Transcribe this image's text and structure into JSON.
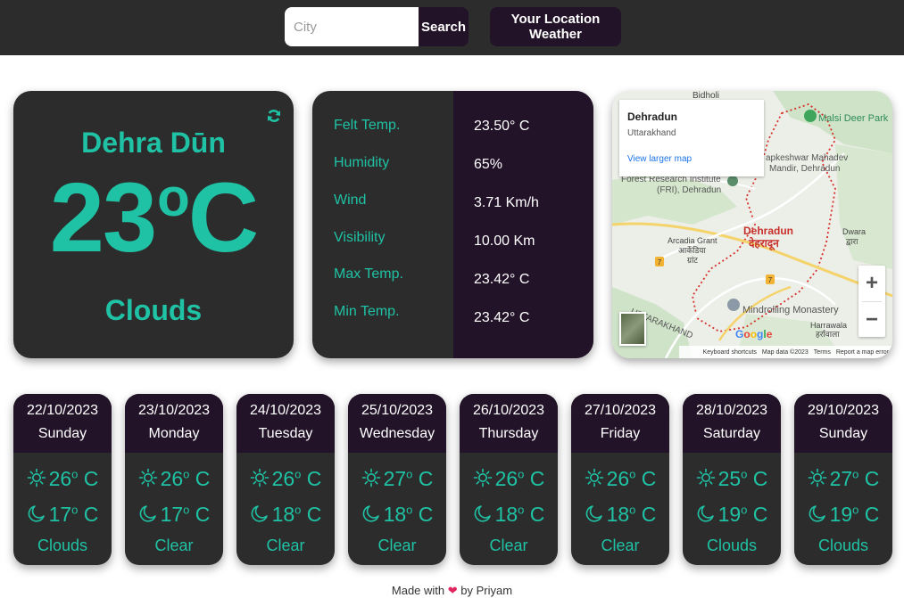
{
  "header": {
    "search_placeholder": "City",
    "search_label": "Search",
    "location_label": "Your Location Weather"
  },
  "current": {
    "city": "Dehra Dūn",
    "temp": "23",
    "unit": "o",
    "unit_letter": "C",
    "condition": "Clouds"
  },
  "details": [
    {
      "label": "Felt Temp.",
      "value": "23.50° C"
    },
    {
      "label": "Humidity",
      "value": "65%"
    },
    {
      "label": "Wind",
      "value": "3.71 Km/h"
    },
    {
      "label": "Visibility",
      "value": "10.00 Km"
    },
    {
      "label": "Max Temp.",
      "value": "23.42° C"
    },
    {
      "label": "Min Temp.",
      "value": "23.42° C"
    }
  ],
  "map": {
    "place_title": "Dehradun",
    "place_sub": "Uttarakhand",
    "view_larger": "View larger map",
    "labels": {
      "bidholi": "Bidholi",
      "malsi": "Malsi Deer Park",
      "tapkeshwar": "apkeshwar Mahadev",
      "tapkeshwar2": "Mandir, Dehradun",
      "fri": "Forest Research Institute",
      "fri2": "(FRI), Dehradun",
      "arcadia": "Arcadia Grant",
      "arcadia_hi": "आर्केडिया",
      "arcadia_hi2": "ग्रांट",
      "dehradun": "Dehradun",
      "dehradun_hi": "देहरादून",
      "dwara": "Dwara",
      "dwara_hi": "द्वारा",
      "mindrolling": "Mindrolling Monastery",
      "harrawala": "Harrawala",
      "harrawala_hi": "हर्रावाला",
      "uttarakhand": "UTTARAKHAND",
      "road7a": "7",
      "road7b": "7"
    },
    "google": "Google",
    "footer": {
      "shortcuts": "Keyboard shortcuts",
      "data": "Map data ©2023",
      "terms": "Terms",
      "report": "Report a map error"
    }
  },
  "forecast": [
    {
      "date": "22/10/2023",
      "day": "Sunday",
      "max": "26",
      "min": "17",
      "cond": "Clouds"
    },
    {
      "date": "23/10/2023",
      "day": "Monday",
      "max": "26",
      "min": "17",
      "cond": "Clear"
    },
    {
      "date": "24/10/2023",
      "day": "Tuesday",
      "max": "26",
      "min": "18",
      "cond": "Clear"
    },
    {
      "date": "25/10/2023",
      "day": "Wednesday",
      "max": "27",
      "min": "18",
      "cond": "Clear"
    },
    {
      "date": "26/10/2023",
      "day": "Thursday",
      "max": "26",
      "min": "18",
      "cond": "Clear"
    },
    {
      "date": "27/10/2023",
      "day": "Friday",
      "max": "26",
      "min": "18",
      "cond": "Clear"
    },
    {
      "date": "28/10/2023",
      "day": "Saturday",
      "max": "25",
      "min": "19",
      "cond": "Clouds"
    },
    {
      "date": "29/10/2023",
      "day": "Sunday",
      "max": "27",
      "min": "19",
      "cond": "Clouds"
    }
  ],
  "temp_unit": {
    "deg": "o",
    "letter": " C"
  },
  "footer": {
    "made_with": "Made with",
    "by": "by Priyam"
  },
  "colors": {
    "accent": "#1fc2a4",
    "dark": "#2c2c2c",
    "purple": "#221328"
  },
  "icons": {
    "refresh": "refresh-icon",
    "sun": "sun-icon",
    "moon": "moon-icon",
    "heart": "heart-icon"
  }
}
